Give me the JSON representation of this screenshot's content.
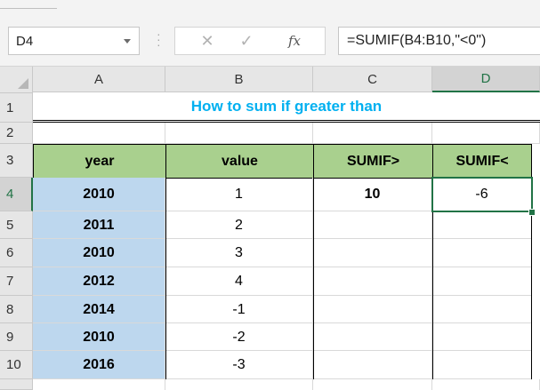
{
  "name_box": {
    "value": "D4"
  },
  "formula_bar": {
    "cancel_glyph": "✕",
    "enter_glyph": "✓",
    "fx_label": "fx",
    "formula": "=SUMIF(B4:B10,\"<0\")"
  },
  "columns": [
    "A",
    "B",
    "C",
    "D"
  ],
  "rows": [
    "1",
    "2",
    "3",
    "4",
    "5",
    "6",
    "7",
    "8",
    "9",
    "10"
  ],
  "active_cell": "D4",
  "title": "How to sum if greater than",
  "table": {
    "headers": [
      "year",
      "value",
      "SUMIF>",
      "SUMIF<"
    ],
    "years": [
      "2010",
      "2011",
      "2010",
      "2012",
      "2014",
      "2010",
      "2016"
    ],
    "values": [
      "1",
      "2",
      "3",
      "4",
      "-1",
      "-2",
      "-3"
    ],
    "sumif_gt": "10",
    "sumif_lt": "-6"
  },
  "colors": {
    "title": "#00b0f0",
    "header_fill": "#a9d08e",
    "year_fill": "#bdd7ee",
    "selection": "#217346"
  }
}
